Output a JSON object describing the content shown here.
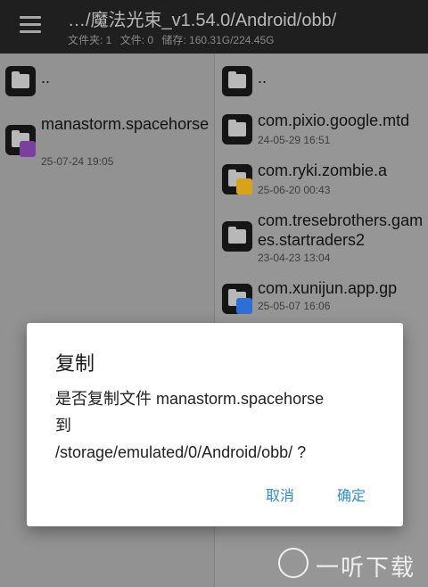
{
  "header": {
    "title": "…/魔法光束_v1.54.0/Android/obb/",
    "folders": "文件夹: 1",
    "files": "文件: 0",
    "storage": "储存: 160.31G/224.45G"
  },
  "left_pane": {
    "items": [
      {
        "name": "..",
        "date": ""
      },
      {
        "name": "manastorm.spacehorse",
        "date": "25-07-24 19:05"
      }
    ]
  },
  "right_pane": {
    "items": [
      {
        "name": "..",
        "date": ""
      },
      {
        "name": "com.pixio.google.mtd",
        "date": "24-05-29 16:51"
      },
      {
        "name": "com.ryki.zombie.a",
        "date": "25-06-20 00:43"
      },
      {
        "name": "com.tresebrothers.games.startraders2",
        "date": "23-04-23 13:04"
      },
      {
        "name": "com.xunijun.app.gp",
        "date": "25-05-07 16:06"
      }
    ]
  },
  "dialog": {
    "title": "复制",
    "message_line1": "是否复制文件 manastorm.spacehorse",
    "message_line2": "到",
    "message_line3": "/storage/emulated/0/Android/obb/ ?",
    "cancel_label": "取消",
    "confirm_label": "确定"
  },
  "watermark": {
    "text": "一听下载"
  }
}
